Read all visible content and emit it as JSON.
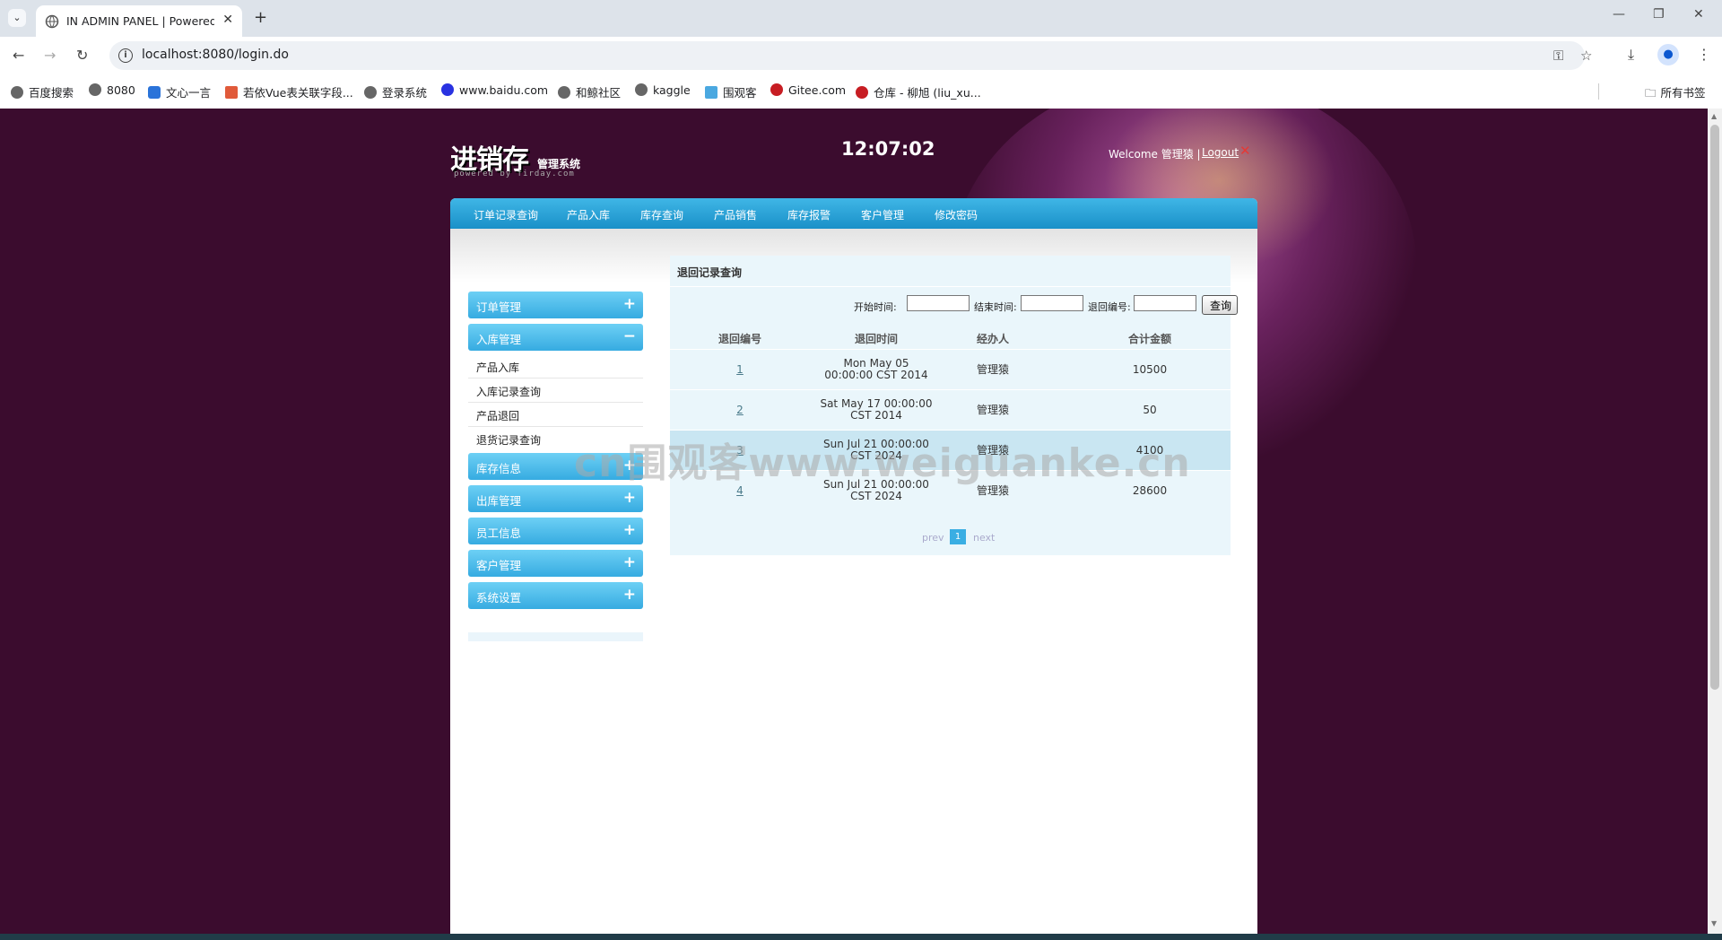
{
  "browser": {
    "tab_title": "IN ADMIN PANEL | Powered b",
    "url": "localhost:8080/login.do",
    "bookmarks": [
      "百度搜索",
      "8080",
      "文心一言",
      "若依Vue表关联字段...",
      "登录系统",
      "www.baidu.com",
      "和鲸社区",
      "kaggle",
      "围观客",
      "Gitee.com",
      "仓库 - 柳旭 (liu_xu..."
    ],
    "all_bookmarks": "所有书签",
    "icons": [
      "chevron-down-icon",
      "globe-icon",
      "close-icon",
      "plus-icon",
      "back-arrow-icon",
      "forward-arrow-icon",
      "reload-icon",
      "info-icon",
      "key-icon",
      "star-icon",
      "download-icon",
      "profile-icon",
      "more-icon",
      "folder-icon"
    ]
  },
  "header": {
    "logo_main": "进销存",
    "logo_sub": "管理系统",
    "logo_powered": "powered by firday.com",
    "clock": "12:07:02",
    "welcome": "Welcome 管理猿 |",
    "logout": "Logout"
  },
  "topnav": [
    "订单记录查询",
    "产品入库",
    "库存查询",
    "产品销售",
    "库存报警",
    "客户管理",
    "修改密码"
  ],
  "sidebar": {
    "sections": [
      {
        "label": "订单管理",
        "sign": "+"
      },
      {
        "label": "入库管理",
        "sign": "−"
      },
      {
        "label": "库存信息",
        "sign": "+"
      },
      {
        "label": "出库管理",
        "sign": "+"
      },
      {
        "label": "员工信息",
        "sign": "+"
      },
      {
        "label": "客户管理",
        "sign": "+"
      },
      {
        "label": "系统设置",
        "sign": "+"
      }
    ],
    "sub_items": [
      "产品入库",
      "入库记录查询",
      "产品退回",
      "退货记录查询"
    ]
  },
  "panel": {
    "title": "退回记录查询",
    "filters": {
      "start_label": "开始时间:",
      "end_label": "结束时间:",
      "id_label": "退回编号:",
      "search_button": "查询"
    },
    "columns": [
      "退回编号",
      "退回时间",
      "经办人",
      "合计金额"
    ],
    "rows": [
      {
        "id": "1",
        "time_l1": "Mon May 05",
        "time_l2": "00:00:00 CST 2014",
        "handler": "管理猿",
        "total": "10500"
      },
      {
        "id": "2",
        "time_l1": "Sat May 17 00:00:00",
        "time_l2": "CST 2014",
        "handler": "管理猿",
        "total": "50"
      },
      {
        "id": "3",
        "time_l1": "Sun Jul 21 00:00:00",
        "time_l2": "CST 2024",
        "handler": "管理猿",
        "total": "4100"
      },
      {
        "id": "4",
        "time_l1": "Sun Jul 21 00:00:00",
        "time_l2": "CST 2024",
        "handler": "管理猿",
        "total": "28600"
      }
    ],
    "pager": {
      "prev": "prev",
      "current": "1",
      "next": "next"
    }
  },
  "watermark": "cn围观客www.weiguanke.cn",
  "colors": {
    "page_bg": "#3b0c2e",
    "nav_blue": "#1a90c8",
    "panel_bg": "#eaf6fb",
    "accordion": "#36abe1"
  }
}
